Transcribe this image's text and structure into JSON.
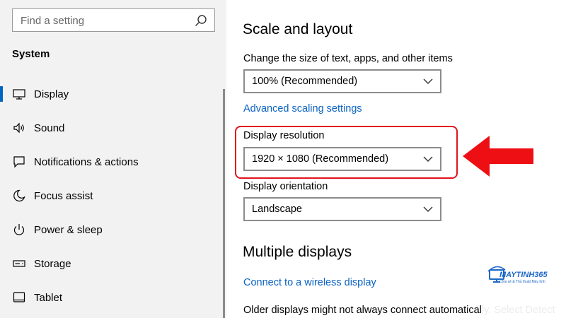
{
  "sidebar": {
    "search_placeholder": "Find a setting",
    "section_title": "System",
    "items": [
      {
        "label": "Display",
        "icon": "monitor-icon",
        "active": true
      },
      {
        "label": "Sound",
        "icon": "speaker-icon"
      },
      {
        "label": "Notifications & actions",
        "icon": "notification-icon"
      },
      {
        "label": "Focus assist",
        "icon": "moon-icon"
      },
      {
        "label": "Power & sleep",
        "icon": "power-icon"
      },
      {
        "label": "Storage",
        "icon": "storage-icon"
      },
      {
        "label": "Tablet",
        "icon": "tablet-icon"
      }
    ]
  },
  "main": {
    "scale_heading": "Scale and layout",
    "scale_label": "Change the size of text, apps, and other items",
    "scale_value": "100% (Recommended)",
    "advanced_link": "Advanced scaling settings",
    "resolution_label": "Display resolution",
    "resolution_value": "1920 × 1080 (Recommended)",
    "orientation_label": "Display orientation",
    "orientation_value": "Landscape",
    "multi_heading": "Multiple displays",
    "wireless_link": "Connect to a wireless display",
    "older_text": "Older displays might not always connect automatically. Select Detect"
  },
  "watermark": {
    "title": "MAYTINH365",
    "subtitle": "Chia sẻ & Thủ thuật Máy tính"
  },
  "colors": {
    "accent": "#0067c0",
    "link": "#0a62c2",
    "highlight": "#e2131e"
  }
}
